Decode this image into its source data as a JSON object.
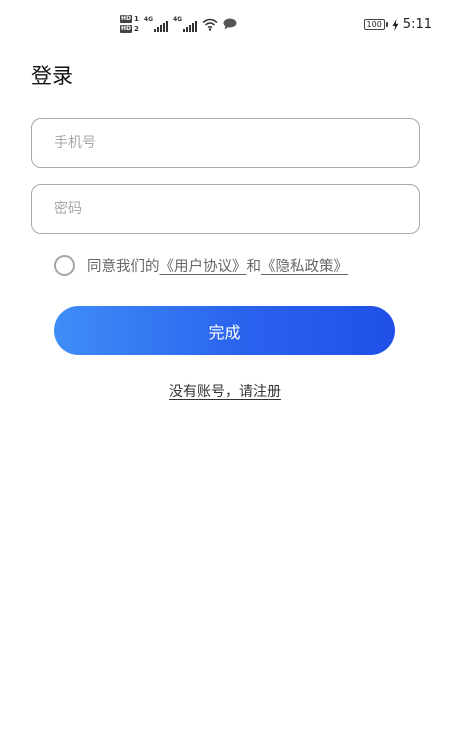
{
  "status_bar": {
    "hd1_label": "HD",
    "hd1_num": "1",
    "hd2_label": "HD",
    "hd2_num": "2",
    "net1_label": "4G",
    "net2_label": "4G",
    "wifi_icon": "wifi-icon",
    "message_icon": "chat-bubble-icon",
    "battery_level": "100",
    "charging_icon": "lightning-icon",
    "time": "5:11"
  },
  "login": {
    "title": "登录",
    "phone_placeholder": "手机号",
    "password_placeholder": "密码",
    "agreement_prefix": "同意我们的",
    "user_agreement": "《用户协议》",
    "agreement_and": "和",
    "privacy_policy": "《隐私政策》",
    "submit_label": "完成",
    "register_link": "没有账号，请注册"
  },
  "colors": {
    "button_gradient_start": "#3f8df7",
    "button_gradient_end": "#1f4fe8",
    "field_border": "#a8a8a8",
    "placeholder": "#a7a7a7"
  }
}
